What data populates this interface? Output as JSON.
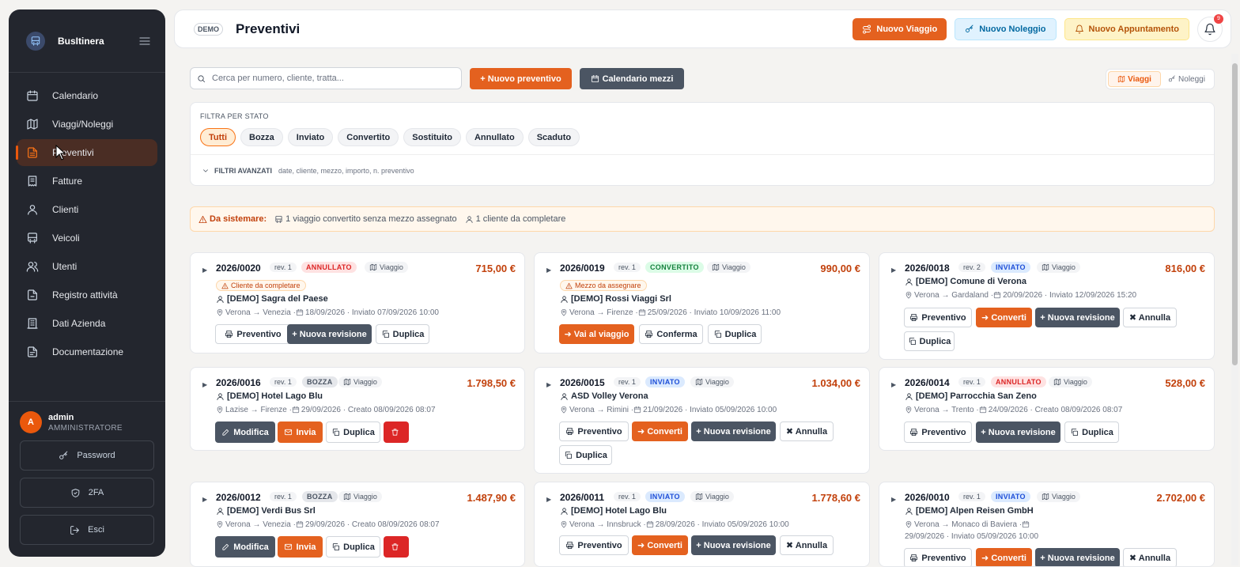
{
  "app": {
    "name": "BusItinera",
    "page_title": "Preventivi",
    "demo_label": "DEMO"
  },
  "sidebar": {
    "items": [
      {
        "label": "Calendario",
        "icon": "calendar-icon"
      },
      {
        "label": "Viaggi/Noleggi",
        "icon": "map-icon"
      },
      {
        "label": "Preventivi",
        "icon": "file-text-icon",
        "active": true
      },
      {
        "label": "Fatture",
        "icon": "receipt-icon"
      },
      {
        "label": "Clienti",
        "icon": "user-icon"
      },
      {
        "label": "Veicoli",
        "icon": "bus-icon"
      },
      {
        "label": "Utenti",
        "icon": "users-icon"
      },
      {
        "label": "Registro attività",
        "icon": "file-list-icon"
      },
      {
        "label": "Dati Azienda",
        "icon": "building-icon"
      },
      {
        "label": "Documentazione",
        "icon": "book-icon"
      }
    ],
    "user": {
      "initial": "A",
      "name": "admin",
      "role": "AMMINISTRATORE"
    },
    "password_label": "Password",
    "twofa_label": "2FA",
    "logout_label": "Esci"
  },
  "header": {
    "nuovo_viaggio": "Nuovo Viaggio",
    "nuovo_noleggio": "Nuovo Noleggio",
    "nuovo_appuntamento": "Nuovo Appuntamento",
    "notifications_count": "9"
  },
  "toolbar": {
    "search_placeholder": "Cerca per numero, cliente, tratta...",
    "new_quote": "+ Nuovo preventivo",
    "calendar_vehicles": "Calendario mezzi",
    "view_trips": "Viaggi",
    "view_rentals": "Noleggi"
  },
  "filters": {
    "title": "FILTRA PER STATO",
    "chips": [
      "Tutti",
      "Bozza",
      "Inviato",
      "Convertito",
      "Sostituito",
      "Annullato",
      "Scaduto"
    ],
    "active": "Tutti",
    "advanced_title": "FILTRI AVANZATI",
    "advanced_desc": "date, cliente, mezzo, importo, n. preventivo"
  },
  "warning": {
    "heading": "Da sistemare:",
    "items": [
      "1 viaggio convertito senza mezzo assegnato",
      "1 cliente da completare"
    ]
  },
  "quotes": [
    {
      "number": "2026/0020",
      "rev": "rev. 1",
      "status": "ANNULLATO",
      "type": "Viaggio",
      "amount": "715,00 €",
      "tag": "Cliente da completare",
      "client": "[DEMO] Sagra del Paese",
      "route": "Verona → Venezia · ",
      "date": "18/09/2026 · Inviato 07/09/2026 10:00",
      "actions": [
        "Preventivo",
        "+ Nuova revisione",
        "Duplica"
      ]
    },
    {
      "number": "2026/0019",
      "rev": "rev. 1",
      "status": "CONVERTITO",
      "type": "Viaggio",
      "amount": "990,00 €",
      "tag": "Mezzo da assegnare",
      "client": "[DEMO] Rossi Viaggi Srl",
      "route": "Verona → Firenze · ",
      "date": "25/09/2026 · Inviato 10/09/2026 11:00",
      "actions": [
        "➜ Vai al viaggio",
        "Conferma",
        "Duplica"
      ]
    },
    {
      "number": "2026/0018",
      "rev": "rev. 2",
      "status": "INVIATO",
      "type": "Viaggio",
      "amount": "816,00 €",
      "tag": "",
      "client": "[DEMO] Comune di Verona",
      "route": "Verona → Gardaland · ",
      "date": "20/09/2026 · Inviato 12/09/2026 15:20",
      "actions": [
        "Preventivo",
        "➜ Converti",
        "+ Nuova revisione",
        "✖ Annulla",
        "Duplica"
      ]
    },
    {
      "number": "2026/0016",
      "rev": "rev. 1",
      "status": "BOZZA",
      "type": "Viaggio",
      "amount": "1.798,50 €",
      "tag": "",
      "client": "[DEMO] Hotel Lago Blu",
      "route": "Lazise → Firenze · ",
      "date": "29/09/2026 · Creato 08/09/2026 08:07",
      "actions": [
        "Modifica",
        "Invia",
        "Duplica",
        "delete"
      ]
    },
    {
      "number": "2026/0015",
      "rev": "rev. 1",
      "status": "INVIATO",
      "type": "Viaggio",
      "amount": "1.034,00 €",
      "tag": "",
      "client": "ASD Volley Verona",
      "route": "Verona → Rimini · ",
      "date": "21/09/2026 · Inviato 05/09/2026 10:00",
      "actions": [
        "Preventivo",
        "➜ Converti",
        "+ Nuova revisione",
        "✖ Annulla",
        "Duplica"
      ]
    },
    {
      "number": "2026/0014",
      "rev": "rev. 1",
      "status": "ANNULLATO",
      "type": "Viaggio",
      "amount": "528,00 €",
      "tag": "",
      "client": "[DEMO] Parrocchia San Zeno",
      "route": "Verona → Trento · ",
      "date": "24/09/2026 · Creato 08/09/2026 08:07",
      "actions": [
        "Preventivo",
        "+ Nuova revisione",
        "Duplica"
      ]
    },
    {
      "number": "2026/0012",
      "rev": "rev. 1",
      "status": "BOZZA",
      "type": "Viaggio",
      "amount": "1.487,90 €",
      "tag": "",
      "client": "[DEMO] Verdi Bus Srl",
      "route": "Verona → Venezia · ",
      "date": "29/09/2026 · Creato 08/09/2026 08:07",
      "actions": [
        "Modifica",
        "Invia",
        "Duplica",
        "delete"
      ]
    },
    {
      "number": "2026/0011",
      "rev": "rev. 1",
      "status": "INVIATO",
      "type": "Viaggio",
      "amount": "1.778,60 €",
      "tag": "",
      "client": "[DEMO] Hotel Lago Blu",
      "route": "Verona → Innsbruck · ",
      "date": "28/09/2026 · Inviato 05/09/2026 10:00",
      "actions": [
        "Preventivo",
        "➜ Converti",
        "+ Nuova revisione",
        "✖ Annulla"
      ]
    },
    {
      "number": "2026/0010",
      "rev": "rev. 1",
      "status": "INVIATO",
      "type": "Viaggio",
      "amount": "2.702,00 €",
      "tag": "",
      "client": "[DEMO] Alpen Reisen GmbH",
      "route": "Verona → Monaco di Baviera · ",
      "date": "29/09/2026 · Inviato 05/09/2026 10:00",
      "actions": [
        "Preventivo",
        "➜ Converti",
        "+ Nuova revisione",
        "✖ Annulla"
      ]
    }
  ]
}
